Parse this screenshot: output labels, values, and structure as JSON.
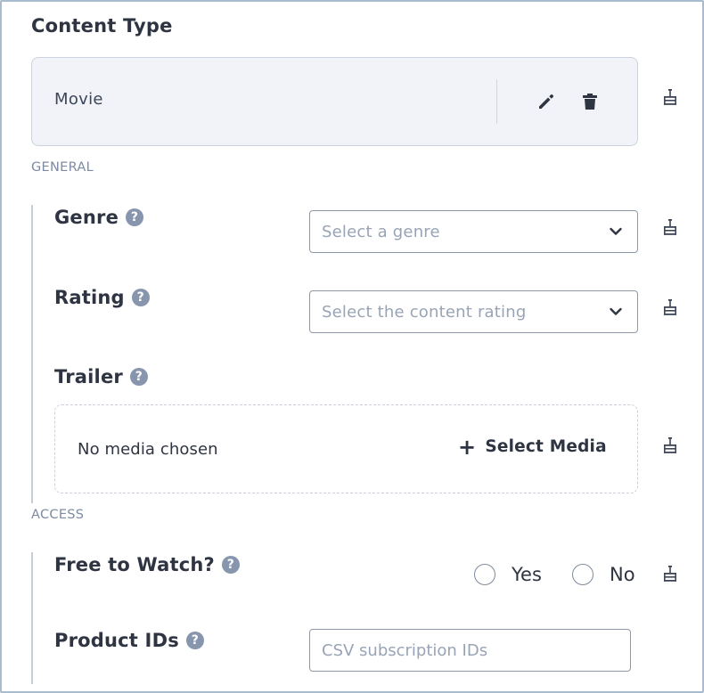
{
  "content_type": {
    "title": "Content Type",
    "value": "Movie",
    "icons": [
      "edit-icon",
      "trash-icon"
    ]
  },
  "groups": {
    "general": "GENERAL",
    "access": "ACCESS"
  },
  "fields": {
    "genre": {
      "label": "Genre",
      "help": "?",
      "placeholder": "Select a genre"
    },
    "rating": {
      "label": "Rating",
      "help": "?",
      "placeholder": "Select the content rating"
    },
    "trailer": {
      "label": "Trailer",
      "help": "?",
      "empty_text": "No media chosen",
      "plus": "+",
      "action": "Select Media"
    },
    "free_to_watch": {
      "label": "Free to Watch?",
      "help": "?",
      "options": [
        "Yes",
        "No"
      ]
    },
    "product_ids": {
      "label": "Product IDs",
      "help": "?",
      "placeholder": "CSV subscription IDs"
    }
  },
  "colors": {
    "border": "#a9bccd",
    "text": "#2e3441",
    "muted": "#7d8ba0",
    "box_bg": "#f1f3f8",
    "help_bg": "#8796ac"
  }
}
